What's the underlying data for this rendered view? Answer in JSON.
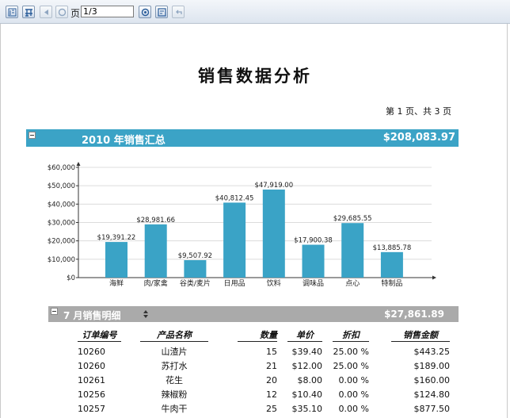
{
  "toolbar": {
    "page_label": "页",
    "page_input": "1/3",
    "buttons": [
      "toc-button",
      "fit-button",
      "prev-page-button",
      "first-page-button",
      "goto-page-button",
      "print-button",
      "back-button"
    ]
  },
  "report": {
    "title": "销售数据分析",
    "page_info": "第 1 页、共 3 页",
    "summary_title": "2010 年销售汇总",
    "summary_total": "$208,083.97"
  },
  "chart_data": {
    "type": "bar",
    "categories": [
      "海鲜",
      "肉/家禽",
      "谷类/麦片",
      "日用品",
      "饮料",
      "调味品",
      "点心",
      "特制品"
    ],
    "values": [
      19391.22,
      28981.66,
      9507.92,
      40812.45,
      47919.0,
      17900.38,
      29685.55,
      13885.78
    ],
    "value_labels": [
      "$19,391.22",
      "$28,981.66",
      "$9,507.92",
      "$40,812.45",
      "$47,919.00",
      "$17,900.38",
      "$29,685.55",
      "$13,885.78"
    ],
    "y_ticks": [
      "$0",
      "$10,000",
      "$20,000",
      "$30,000",
      "$40,000",
      "$50,000",
      "$60,000"
    ],
    "y_top_label": "$60,000",
    "ylim": [
      0,
      60000
    ],
    "grid": true,
    "color": "#3aa3c6"
  },
  "month_section": {
    "title": "7 月销售明细",
    "total": "$27,861.89"
  },
  "table": {
    "headers": [
      "订单编号",
      "产品名称",
      "数量",
      "单价",
      "折扣",
      "销售金额"
    ],
    "rows": [
      [
        "10260",
        "山渣片",
        "15",
        "$39.40",
        "25.00 %",
        "$443.25"
      ],
      [
        "10260",
        "苏打水",
        "21",
        "$12.00",
        "25.00 %",
        "$189.00"
      ],
      [
        "10261",
        "花生",
        "20",
        "$8.00",
        "0.00 %",
        "$160.00"
      ],
      [
        "10256",
        "辣椒粉",
        "12",
        "$10.40",
        "0.00 %",
        "$124.80"
      ],
      [
        "10257",
        "牛肉干",
        "25",
        "$35.10",
        "0.00 %",
        "$877.50"
      ]
    ]
  },
  "colors": {
    "accent": "#3ba3c6",
    "month_bar": "#aaaaaa"
  }
}
